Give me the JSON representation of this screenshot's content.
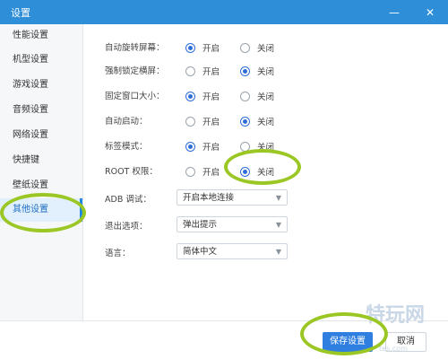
{
  "window": {
    "title": "设置",
    "minimize": "—",
    "close": "✕"
  },
  "sidebar": {
    "items": [
      {
        "label": "性能设置"
      },
      {
        "label": "机型设置"
      },
      {
        "label": "游戏设置"
      },
      {
        "label": "音频设置"
      },
      {
        "label": "网络设置"
      },
      {
        "label": "快捷键"
      },
      {
        "label": "壁纸设置"
      },
      {
        "label": "其他设置",
        "active": true
      }
    ]
  },
  "settings": {
    "rows": [
      {
        "label": "自动旋转屏幕：",
        "on": "开启",
        "off": "关闭",
        "selected": "on"
      },
      {
        "label": "强制锁定横屏：",
        "on": "开启",
        "off": "关闭",
        "selected": "off"
      },
      {
        "label": "固定窗口大小：",
        "on": "开启",
        "off": "关闭",
        "selected": "on"
      },
      {
        "label": "自动启动：",
        "on": "开启",
        "off": "关闭",
        "selected": "off"
      },
      {
        "label": "标签模式：",
        "on": "开启",
        "off": "关闭",
        "selected": "on"
      },
      {
        "label": "ROOT 权限：",
        "on": "开启",
        "off": "关闭",
        "selected": "off"
      }
    ],
    "adb": {
      "label": "ADB 调试：",
      "value": "开启本地连接"
    },
    "exit": {
      "label": "退出选项：",
      "value": "弹出提示"
    },
    "language": {
      "label": "语言：",
      "value": "简体中文"
    }
  },
  "footer": {
    "save_label": "保存设置",
    "cancel_label": "取消"
  },
  "watermark": {
    "text": "特玩网",
    "sub": "tes.com"
  },
  "colors": {
    "accent": "#2f7fe0",
    "titlebar": "#2f8ed8",
    "highlight": "#9bc724"
  }
}
